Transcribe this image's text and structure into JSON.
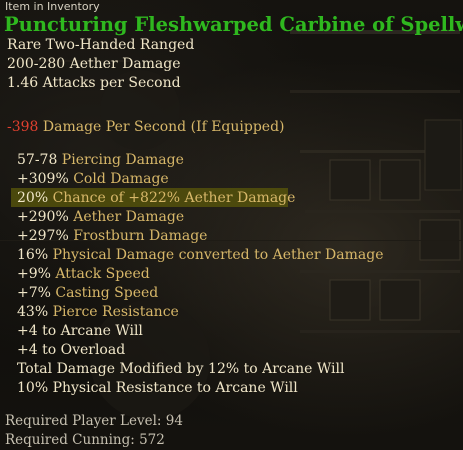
{
  "header": "Item in Inventory",
  "item": {
    "name": "Puncturing Fleshwarped Carbine of Spellweaving",
    "type": "Rare Two-Handed Ranged",
    "base_damage": "200-280 Aether Damage",
    "attack_speed": "1.46 Attacks per Second",
    "dps_value": "-398",
    "dps_label": " Damage Per Second (If Equipped)",
    "stats": [
      {
        "value": "57-78",
        "label": " Piercing Damage"
      },
      {
        "value": "+309%",
        "label": " Cold Damage"
      },
      {
        "value": "20%",
        "label": " Chance of +822% Aether Damage"
      },
      {
        "value": "+290%",
        "label": " Aether Damage"
      },
      {
        "value": "+297%",
        "label": " Frostburn Damage"
      },
      {
        "value": "16%",
        "label": " Physical Damage converted to Aether Damage"
      },
      {
        "value": "+9%",
        "label": " Attack Speed"
      },
      {
        "value": "+7%",
        "label": " Casting Speed"
      },
      {
        "value": "43%",
        "label": " Pierce Resistance"
      },
      {
        "value": "+4 to Arcane Will",
        "label": ""
      },
      {
        "value": "+4 to Overload",
        "label": ""
      },
      {
        "value": "Total Damage Modified by 12% to Arcane Will",
        "label": ""
      },
      {
        "value": "10% Physical Resistance to Arcane Will",
        "label": ""
      }
    ],
    "requirements": {
      "level_label": "Required Player Level: ",
      "level_value": "94",
      "cunning_label": "Required Cunning: ",
      "cunning_value": "572"
    }
  },
  "colors": {
    "title": "#2fb81f",
    "base_text": "#f0e6c8",
    "stat_label": "#d7b769",
    "negative": "#e0402f",
    "highlight": "#58560a"
  }
}
